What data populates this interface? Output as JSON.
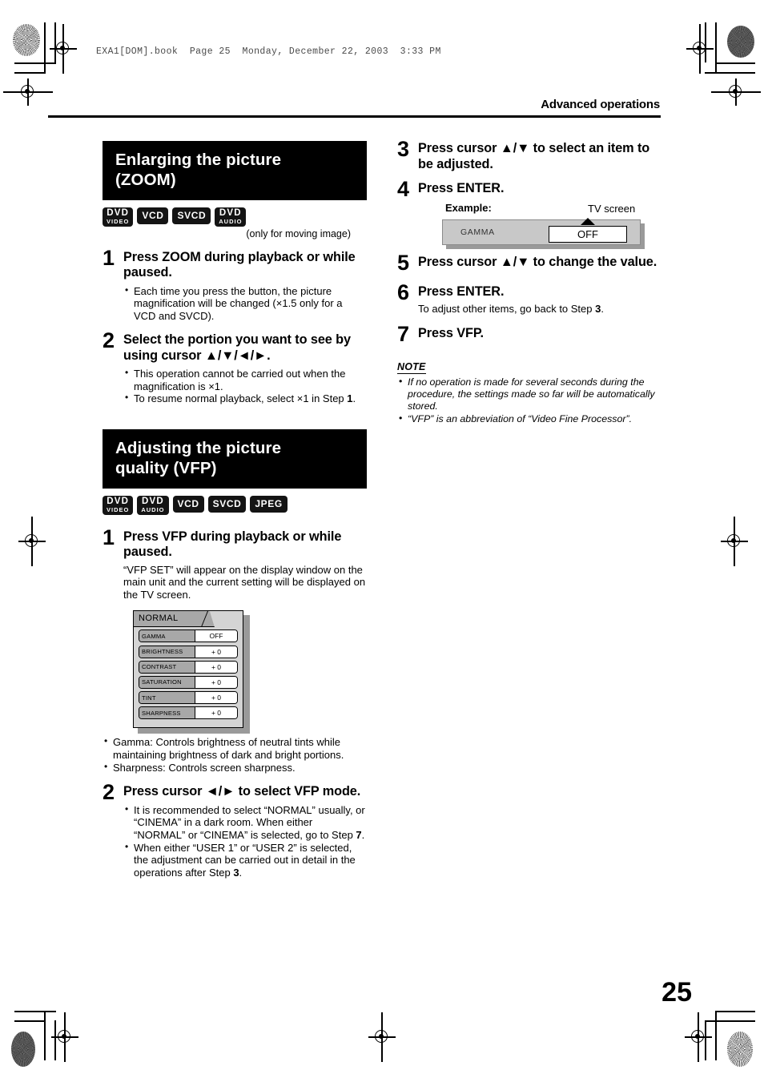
{
  "page": {
    "filestamp": "EXA1[DOM].book  Page 25  Monday, December 22, 2003  3:33 PM",
    "section_label": "Advanced operations",
    "page_number": "25"
  },
  "left_column": {
    "section1": {
      "title_line1": "Enlarging the picture",
      "title_line2": "(ZOOM)",
      "badges": [
        {
          "top": "DVD",
          "bottom": "VIDEO"
        },
        {
          "top": "VCD",
          "bottom": ""
        },
        {
          "top": "SVCD",
          "bottom": ""
        },
        {
          "top": "DVD",
          "bottom": "AUDIO"
        }
      ],
      "badge_note": "(only for moving image)",
      "steps": [
        {
          "num": "1",
          "head": "Press ZOOM during playback or while paused.",
          "bullets": [
            "Each time you press the button, the picture magnification will be changed (×1.5 only for a VCD and SVCD)."
          ]
        },
        {
          "num": "2",
          "head": "Select the portion you want to see by using cursor ▲/▼/◄/►.",
          "bullets": [
            "This operation cannot be carried out when the magnification is ×1.",
            "To resume normal playback, select ×1 in Step 1."
          ]
        }
      ]
    },
    "section2": {
      "title_line1": "Adjusting the picture",
      "title_line2": "quality (VFP)",
      "badges": [
        {
          "top": "DVD",
          "bottom": "VIDEO"
        },
        {
          "top": "DVD",
          "bottom": "AUDIO"
        },
        {
          "top": "VCD",
          "bottom": ""
        },
        {
          "top": "SVCD",
          "bottom": ""
        },
        {
          "top": "JPEG",
          "bottom": ""
        }
      ],
      "step1": {
        "num": "1",
        "head": "Press VFP during playback or while paused.",
        "text": "“VFP SET” will appear on the display window on the main unit and the current setting will be displayed on the TV screen.",
        "bullets": [
          "Gamma: Controls brightness of neutral tints while maintaining brightness of dark and bright portions.",
          "Sharpness: Controls screen sharpness."
        ]
      },
      "vfp_panel": {
        "tab_label": "NORMAL",
        "rows": [
          {
            "label": "GAMMA",
            "value": "OFF"
          },
          {
            "label": "BRIGHTNESS",
            "value": "+ 0"
          },
          {
            "label": "CONTRAST",
            "value": "+ 0"
          },
          {
            "label": "SATURATION",
            "value": "+ 0"
          },
          {
            "label": "TINT",
            "value": "+ 0"
          },
          {
            "label": "SHARPNESS",
            "value": "+ 0"
          }
        ]
      },
      "step2": {
        "num": "2",
        "head": "Press cursor ◄/► to select VFP mode.",
        "bullets": [
          "It is recommended to select “NORMAL” usually, or “CINEMA” in a dark room. When either “NORMAL” or “CINEMA” is selected, go to Step 7.",
          "When either  “USER 1” or “USER 2” is selected, the adjustment can be carried out in detail in the operations after Step 3."
        ]
      }
    }
  },
  "right_column": {
    "step3": {
      "num": "3",
      "head": "Press cursor ▲/▼ to select an item to be adjusted."
    },
    "step4": {
      "num": "4",
      "head": "Press ENTER."
    },
    "example": {
      "label": "Example:",
      "tv_label": "TV screen",
      "item_name": "GAMMA",
      "item_value": "OFF"
    },
    "step5": {
      "num": "5",
      "head": "Press cursor ▲/▼ to change the value."
    },
    "step6": {
      "num": "6",
      "head": "Press ENTER.",
      "text": "To adjust other items, go back to Step 3."
    },
    "step7": {
      "num": "7",
      "head": "Press VFP."
    },
    "note": {
      "title": "NOTE",
      "items": [
        "If no operation is made for several seconds during the procedure, the settings made so far will be automatically stored.",
        "“VFP” is an abbreviation of “Video Fine Processor”."
      ]
    }
  }
}
